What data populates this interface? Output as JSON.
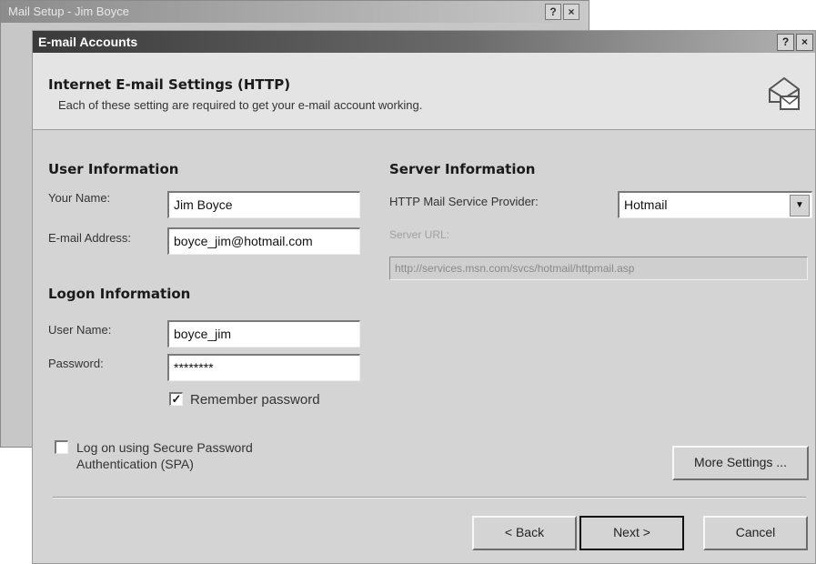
{
  "background_window": {
    "title": "Mail Setup - Jim Boyce",
    "buttons": [
      "?",
      "×"
    ]
  },
  "dialog": {
    "title": "E-mail Accounts",
    "title_buttons": [
      "?",
      "×"
    ],
    "header": {
      "heading": "Internet E-mail Settings (HTTP)",
      "description": "Each of these setting are required to get your e-mail account working."
    },
    "user_info": {
      "title": "User Information",
      "name_label": "Your Name:",
      "name_value": "Jim Boyce",
      "email_label": "E-mail Address:",
      "email_value": "boyce_jim@hotmail.com"
    },
    "logon_info": {
      "title": "Logon Information",
      "username_label": "User Name:",
      "username_value": "boyce_jim",
      "password_label": "Password:",
      "password_value": "********",
      "remember_label": "Remember password",
      "remember_checked": true
    },
    "server_info": {
      "title": "Server Information",
      "provider_label": "HTTP Mail Service Provider:",
      "provider_value": "Hotmail",
      "url_label": "Server URL:",
      "url_value": "http://services.msn.com/svcs/hotmail/httpmail.asp"
    },
    "spa": {
      "label_line1": "Log on using Secure Password",
      "label_line2": "Authentication (SPA)",
      "checked": false
    },
    "buttons": {
      "more_settings": "More Settings ...",
      "back": "< Back",
      "next": "Next >",
      "cancel": "Cancel"
    }
  }
}
